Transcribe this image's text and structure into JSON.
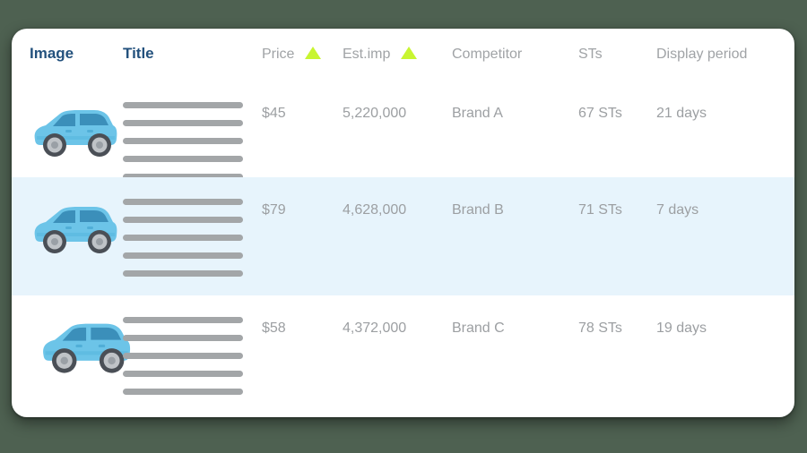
{
  "theme": {
    "page_background": "#4e6151",
    "card_background": "#ffffff",
    "header_dark_text": "#23517d",
    "muted_text": "#9c9fa2",
    "sort_triangle": "#c8f531",
    "highlight_row": "#e7f4fc",
    "skeleton_bar": "#a3a6a8",
    "car_body": "#6cc4e8",
    "car_glass": "#3b8fba",
    "car_wheel": "#b9bcbf"
  },
  "table": {
    "columns": [
      {
        "key": "image",
        "label": "Image",
        "emphasis": "dark",
        "sortable": false
      },
      {
        "key": "title",
        "label": "Title",
        "emphasis": "dark",
        "sortable": false
      },
      {
        "key": "price",
        "label": "Price",
        "emphasis": "muted",
        "sortable": true,
        "sort_direction": "asc"
      },
      {
        "key": "est_imp",
        "label": "Est.imp",
        "emphasis": "muted",
        "sortable": true,
        "sort_direction": "asc"
      },
      {
        "key": "competitor",
        "label": "Competitor",
        "emphasis": "muted",
        "sortable": false
      },
      {
        "key": "sts",
        "label": "STs",
        "emphasis": "muted",
        "sortable": false
      },
      {
        "key": "display_period",
        "label": "Display period",
        "emphasis": "muted",
        "sortable": false
      }
    ],
    "rows": [
      {
        "image_icon": "blue-hatchback-car-icon",
        "title_placeholder_lines": 5,
        "price": "$45",
        "est_imp": "5,220,000",
        "competitor": "Brand A",
        "sts": "67 STs",
        "display_period": "21 days",
        "highlighted": false
      },
      {
        "image_icon": "blue-hatchback-car-icon",
        "title_placeholder_lines": 5,
        "price": "$79",
        "est_imp": "4,628,000",
        "competitor": "Brand B",
        "sts": "71 STs",
        "display_period": "7 days",
        "highlighted": true
      },
      {
        "image_icon": "blue-hatchback-car-icon",
        "title_placeholder_lines": 5,
        "price": "$58",
        "est_imp": "4,372,000",
        "competitor": "Brand C",
        "sts": "78 STs",
        "display_period": "19 days",
        "highlighted": false
      }
    ]
  }
}
